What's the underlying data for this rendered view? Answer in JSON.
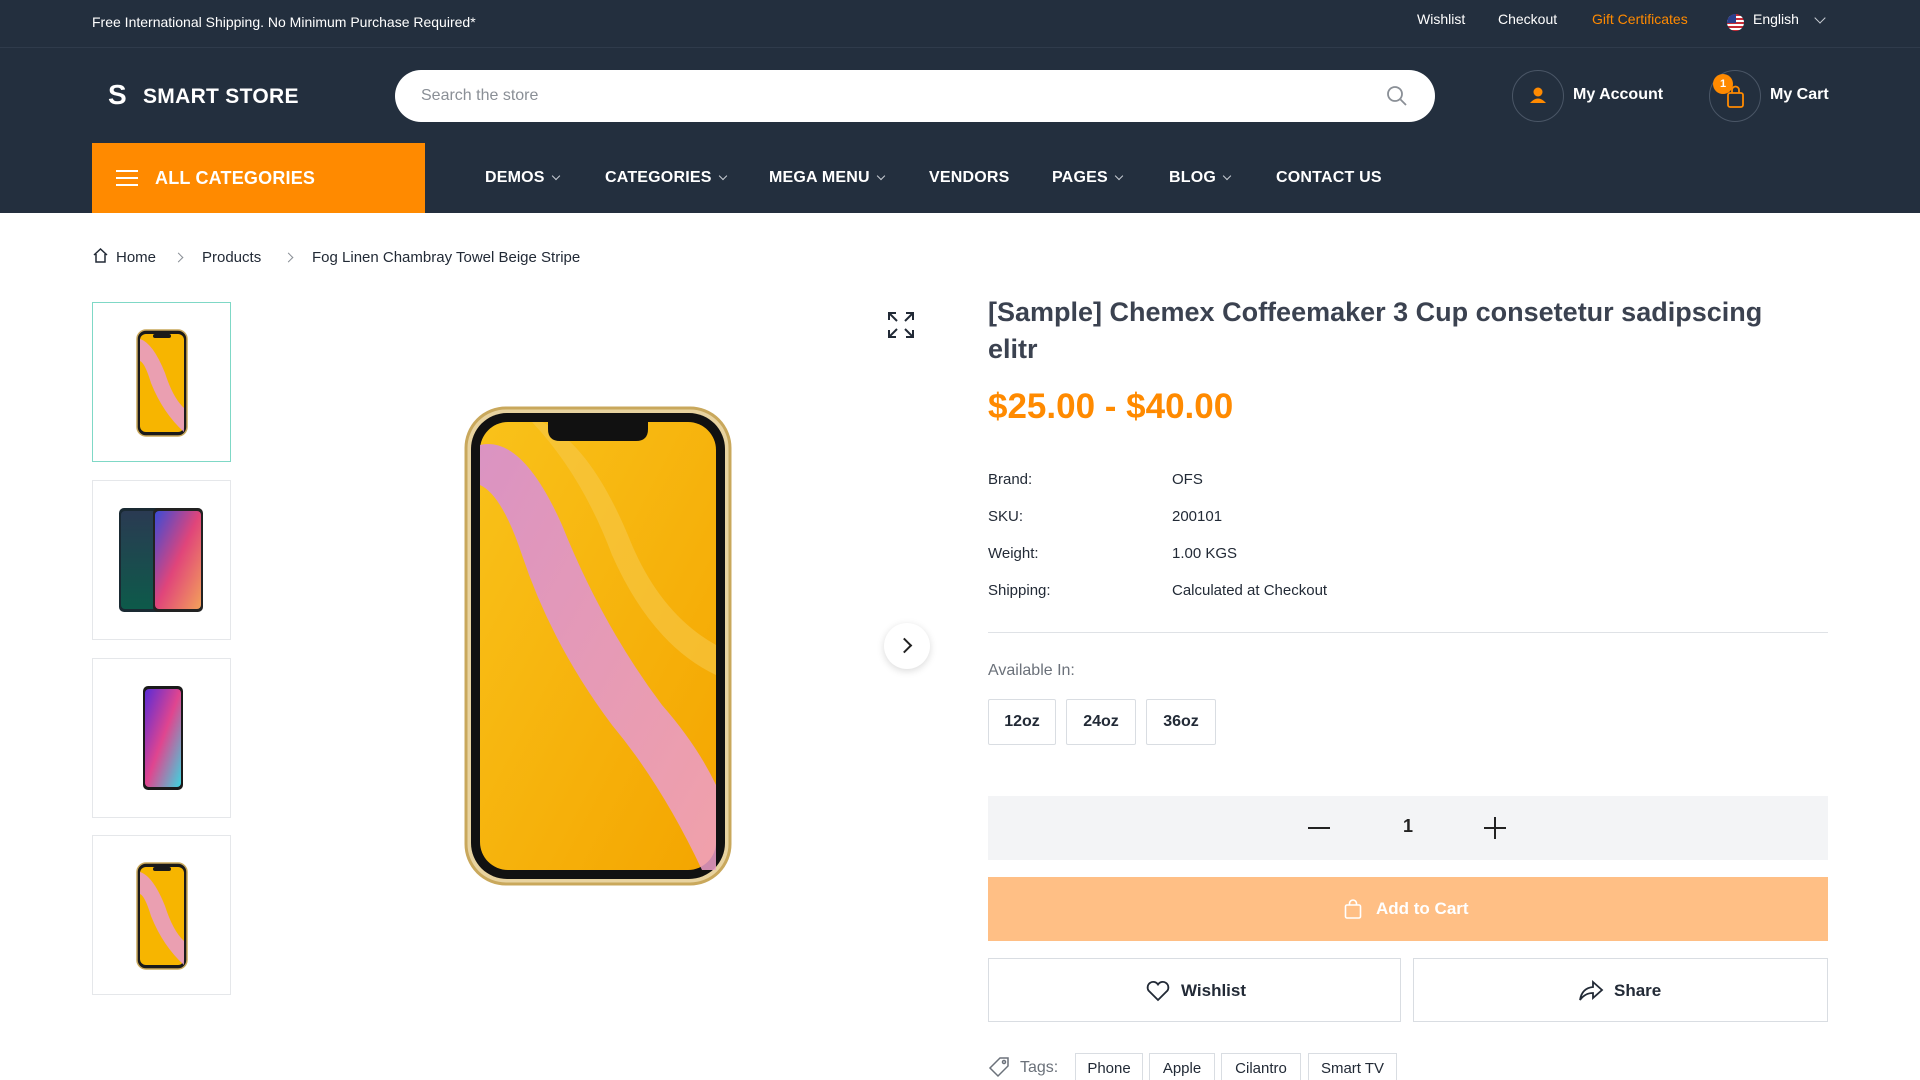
{
  "topbar": {
    "promo": "Free International Shipping. No Minimum Purchase Required*",
    "links": [
      "Wishlist",
      "Checkout",
      "Gift Certificates"
    ],
    "language": "English",
    "accent_color": "#ff8a00"
  },
  "header": {
    "logo_letter": "S",
    "logo_text": "SMART STORE",
    "search_placeholder": "Search the store",
    "account_label": "My Account",
    "cart_label": "My Cart",
    "cart_count": "1"
  },
  "nav": {
    "all_categories": "ALL CATEGORIES",
    "items": [
      "DEMOS",
      "CATEGORIES",
      "MEGA MENU",
      "VENDORS",
      "PAGES",
      "BLOG",
      "CONTACT US"
    ]
  },
  "breadcrumb": [
    "Home",
    "Products",
    "Fog Linen Chambray Towel Beige Stripe"
  ],
  "product": {
    "title": "[Sample] Chemex Coffeemaker 3 Cup consetetur sadipscing elitr",
    "price": "$25.00 - $40.00",
    "specs": [
      {
        "key": "Brand:",
        "value": "OFS"
      },
      {
        "key": "SKU:",
        "value": "200101"
      },
      {
        "key": "Weight:",
        "value": "1.00 KGS"
      },
      {
        "key": "Shipping:",
        "value": "Calculated at Checkout"
      }
    ],
    "available_label": "Available In:",
    "options": [
      "12oz",
      "24oz",
      "36oz"
    ],
    "quantity": "1",
    "add_to_cart": "Add to Cart",
    "wishlist": "Wishlist",
    "share": "Share",
    "tags_label": "Tags:",
    "tags": [
      "Phone",
      "Apple",
      "Cilantro",
      "Smart TV"
    ]
  },
  "gallery": {
    "thumbnails": [
      "yellow-phone",
      "dark-gradient-phone",
      "pink-gradient-phone",
      "yellow-phone"
    ]
  }
}
